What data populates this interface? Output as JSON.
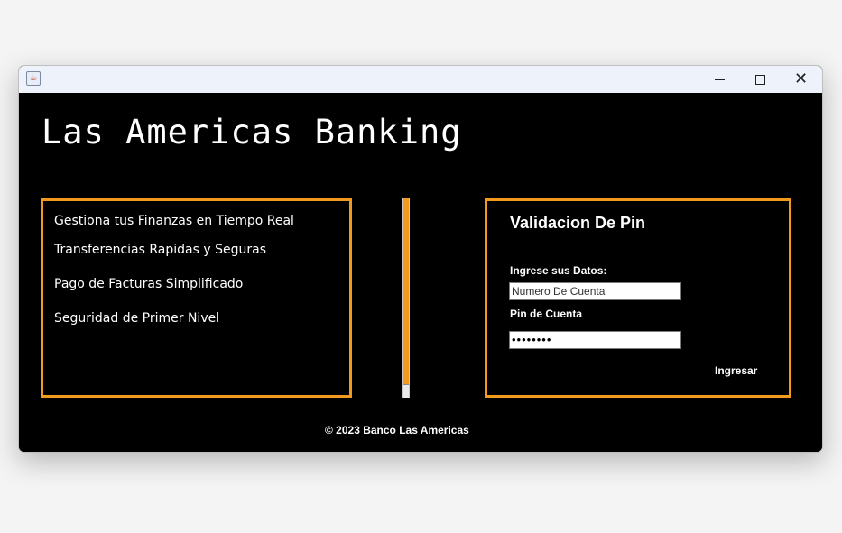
{
  "window": {
    "controls": {
      "minimize_icon": "minimize-icon",
      "maximize_icon": "maximize-icon",
      "close_icon": "close-icon"
    }
  },
  "header": {
    "title": "Las Americas Banking"
  },
  "features": {
    "items": [
      "Gestiona tus Finanzas en Tiempo Real",
      "Transferencias Rapidas y Seguras",
      "Pago de Facturas Simplificado",
      "Seguridad de Primer Nivel"
    ]
  },
  "login": {
    "title": "Validacion De Pin",
    "data_label": "Ingrese sus Datos:",
    "account_value": "Numero De Cuenta",
    "pin_label": "Pin de Cuenta",
    "pin_value": "••••••••",
    "submit_label": "Ingresar"
  },
  "footer": {
    "text": "© 2023 Banco Las Americas"
  },
  "colors": {
    "accent": "#f39a1e",
    "background": "#000000",
    "text": "#ffffff"
  }
}
